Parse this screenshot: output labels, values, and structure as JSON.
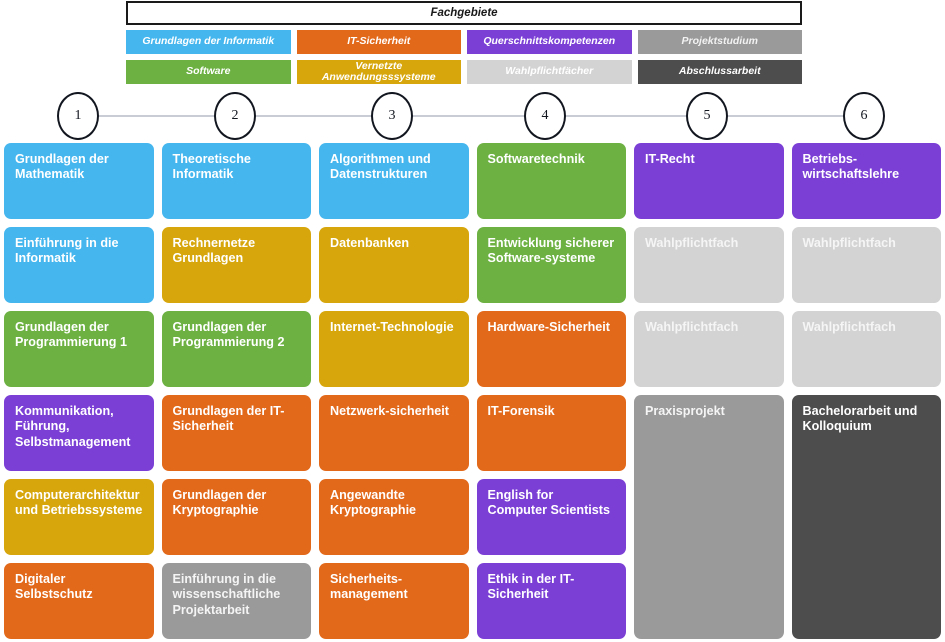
{
  "legend": {
    "title": "Fachgebiete",
    "items": [
      {
        "label": "Grundlagen der Informatik",
        "color": "#45B6EE",
        "text": "#ffffff"
      },
      {
        "label": "IT-Sicherheit",
        "color": "#E2681A",
        "text": "#ffffff"
      },
      {
        "label": "Querschnittskompetenzen",
        "color": "#7B3FD6",
        "text": "#ffffff"
      },
      {
        "label": "Projektstudium",
        "color": "#9A9A9A",
        "text": "#f2f2f2"
      },
      {
        "label": "Software",
        "color": "#6CB142",
        "text": "#ffffff"
      },
      {
        "label": "Vernetzte Anwendungsssysteme",
        "color": "#D6A60C",
        "text": "#ffffff"
      },
      {
        "label": "Wahlpflichtfächer",
        "color": "#D3D3D3",
        "text": "#ffffff"
      },
      {
        "label": "Abschlussarbeit",
        "color": "#4D4D4D",
        "text": "#ffffff"
      }
    ]
  },
  "timeline": {
    "semesters": [
      "1",
      "2",
      "3",
      "4",
      "5",
      "6"
    ],
    "line_color": "#c9ccd4"
  },
  "palette": {
    "grundlagen_informatik": "#45B6EE",
    "it_sicherheit": "#E2681A",
    "querschnittskompetenzen": "#7B3FD6",
    "projektstudium": "#9A9A9A",
    "software": "#6CB142",
    "vernetzte_anwendungssysteme": "#D6A60C",
    "wahlpflichtfaecher": "#D3D3D3",
    "abschlussarbeit": "#4D4D4D"
  },
  "courses": [
    {
      "label": "Grundlagen der Mathematik",
      "color": "#45B6EE",
      "col": 1,
      "row": 1,
      "span": 1,
      "pale": false
    },
    {
      "label": "Einführung in die Informatik",
      "color": "#45B6EE",
      "col": 1,
      "row": 2,
      "span": 1,
      "pale": false
    },
    {
      "label": "Grundlagen der Programmierung 1",
      "color": "#6CB142",
      "col": 1,
      "row": 3,
      "span": 1,
      "pale": false
    },
    {
      "label": "Kommunikation, Führung, Selbstmanagement",
      "color": "#7B3FD6",
      "col": 1,
      "row": 4,
      "span": 1,
      "pale": false
    },
    {
      "label": "Computerarchitektur und Betriebssysteme",
      "color": "#D6A60C",
      "col": 1,
      "row": 5,
      "span": 1,
      "pale": false
    },
    {
      "label": "Digitaler Selbstschutz",
      "color": "#E2681A",
      "col": 1,
      "row": 6,
      "span": 1,
      "pale": false
    },
    {
      "label": "Theoretische Informatik",
      "color": "#45B6EE",
      "col": 2,
      "row": 1,
      "span": 1,
      "pale": false
    },
    {
      "label": "Rechnernetze Grundlagen",
      "color": "#D6A60C",
      "col": 2,
      "row": 2,
      "span": 1,
      "pale": false
    },
    {
      "label": "Grundlagen der Programmierung 2",
      "color": "#6CB142",
      "col": 2,
      "row": 3,
      "span": 1,
      "pale": false
    },
    {
      "label": "Grundlagen der IT-Sicherheit",
      "color": "#E2681A",
      "col": 2,
      "row": 4,
      "span": 1,
      "pale": false
    },
    {
      "label": "Grundlagen der Kryptographie",
      "color": "#E2681A",
      "col": 2,
      "row": 5,
      "span": 1,
      "pale": false
    },
    {
      "label": "Einführung in die wissenschaftliche Projektarbeit",
      "color": "#9A9A9A",
      "col": 2,
      "row": 6,
      "span": 1,
      "pale": true
    },
    {
      "label": "Algorithmen und Datenstrukturen",
      "color": "#45B6EE",
      "col": 3,
      "row": 1,
      "span": 1,
      "pale": false
    },
    {
      "label": "Datenbanken",
      "color": "#D6A60C",
      "col": 3,
      "row": 2,
      "span": 1,
      "pale": false
    },
    {
      "label": "Internet-Technologie",
      "color": "#D6A60C",
      "col": 3,
      "row": 3,
      "span": 1,
      "pale": false
    },
    {
      "label": "Netzwerk-sicherheit",
      "color": "#E2681A",
      "col": 3,
      "row": 4,
      "span": 1,
      "pale": false
    },
    {
      "label": "Angewandte Kryptographie",
      "color": "#E2681A",
      "col": 3,
      "row": 5,
      "span": 1,
      "pale": false
    },
    {
      "label": "Sicherheits-management",
      "color": "#E2681A",
      "col": 3,
      "row": 6,
      "span": 1,
      "pale": false
    },
    {
      "label": "Softwaretechnik",
      "color": "#6CB142",
      "col": 4,
      "row": 1,
      "span": 1,
      "pale": false
    },
    {
      "label": "Entwicklung sicherer Software-systeme",
      "color": "#6CB142",
      "col": 4,
      "row": 2,
      "span": 1,
      "pale": false
    },
    {
      "label": "Hardware-Sicherheit",
      "color": "#E2681A",
      "col": 4,
      "row": 3,
      "span": 1,
      "pale": false
    },
    {
      "label": "IT-Forensik",
      "color": "#E2681A",
      "col": 4,
      "row": 4,
      "span": 1,
      "pale": false
    },
    {
      "label": "English for Computer Scientists",
      "color": "#7B3FD6",
      "col": 4,
      "row": 5,
      "span": 1,
      "pale": false
    },
    {
      "label": "Ethik in der IT-Sicherheit",
      "color": "#7B3FD6",
      "col": 4,
      "row": 6,
      "span": 1,
      "pale": false
    },
    {
      "label": "IT-Recht",
      "color": "#7B3FD6",
      "col": 5,
      "row": 1,
      "span": 1,
      "pale": false
    },
    {
      "label": "Wahlpflichtfach",
      "color": "#D3D3D3",
      "col": 5,
      "row": 2,
      "span": 1,
      "pale": true
    },
    {
      "label": "Wahlpflichtfach",
      "color": "#D3D3D3",
      "col": 5,
      "row": 3,
      "span": 1,
      "pale": true
    },
    {
      "label": "Praxisprojekt",
      "color": "#9A9A9A",
      "col": 5,
      "row": 4,
      "span": 3,
      "pale": true
    },
    {
      "label": "Betriebs-wirtschaftslehre",
      "color": "#7B3FD6",
      "col": 6,
      "row": 1,
      "span": 1,
      "pale": false
    },
    {
      "label": "Wahlpflichtfach",
      "color": "#D3D3D3",
      "col": 6,
      "row": 2,
      "span": 1,
      "pale": true
    },
    {
      "label": "Wahlpflichtfach",
      "color": "#D3D3D3",
      "col": 6,
      "row": 3,
      "span": 1,
      "pale": true
    },
    {
      "label": "Bachelorarbeit und Kolloquium",
      "color": "#4D4D4D",
      "col": 6,
      "row": 4,
      "span": 3,
      "pale": false
    }
  ]
}
